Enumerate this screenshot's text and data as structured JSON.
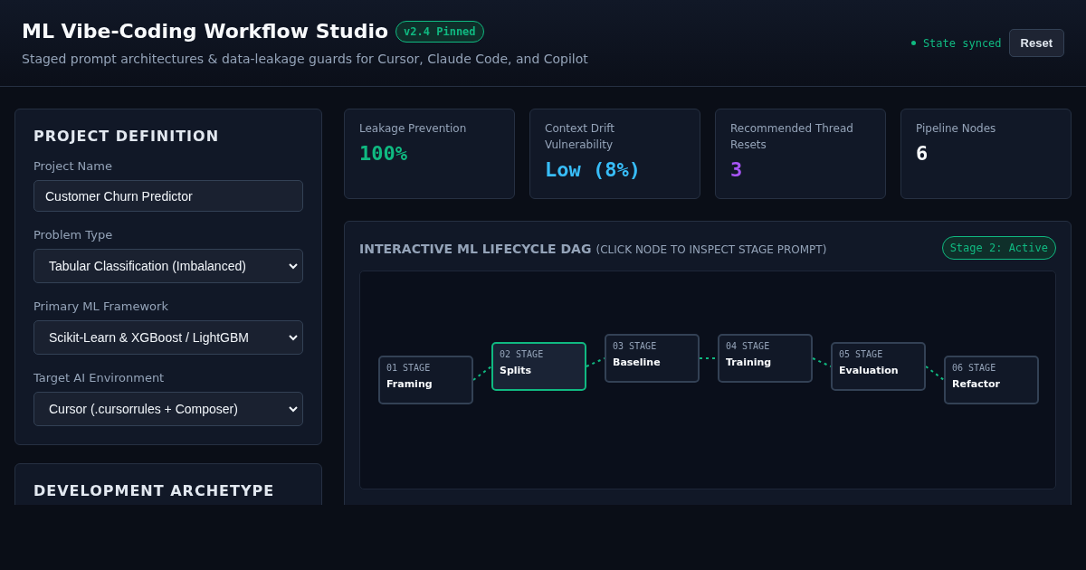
{
  "header": {
    "title": "ML Vibe-Coding Workflow Studio",
    "version_badge": "v2.4 Pinned",
    "subtitle": "Staged prompt architectures & data-leakage guards for Cursor, Claude Code, and Copilot",
    "sync_status": "State synced",
    "reset_button": "Reset"
  },
  "project_definition": {
    "title": "PROJECT DEFINITION",
    "fields": [
      {
        "kind": "text",
        "label": "Project Name",
        "value": "Customer Churn Predictor"
      },
      {
        "kind": "select",
        "label": "Problem Type",
        "value": "Tabular Classification (Imbalanced)"
      },
      {
        "kind": "select",
        "label": "Primary ML Framework",
        "value": "Scikit-Learn & XGBoost / LightGBM"
      },
      {
        "kind": "select",
        "label": "Target AI Environment",
        "value": "Cursor (.cursorrules + Composer)"
      }
    ]
  },
  "development_archetype": {
    "title": "DEVELOPMENT ARCHETYPE"
  },
  "metrics": [
    {
      "label": "Leakage Prevention",
      "value": "100%",
      "color": "#10b981"
    },
    {
      "label": "Context Drift Vulnerability",
      "value": "Low (8%)",
      "color": "#38bdf8"
    },
    {
      "label": "Recommended Thread Resets",
      "value": "3",
      "color": "#a855f7"
    },
    {
      "label": "Pipeline Nodes",
      "value": "6",
      "color": "#f8fafc"
    }
  ],
  "dag": {
    "title": "INTERACTIVE ML LIFECYCLE DAG",
    "hint": "(CLICK NODE TO INSPECT STAGE PROMPT)",
    "status_badge": "Stage 2: Active",
    "nodes": [
      {
        "stage": "01 STAGE",
        "name": "Framing",
        "selected": false
      },
      {
        "stage": "02 STAGE",
        "name": "Splits",
        "selected": true
      },
      {
        "stage": "03 STAGE",
        "name": "Baseline",
        "selected": false
      },
      {
        "stage": "04 STAGE",
        "name": "Training",
        "selected": false
      },
      {
        "stage": "05 STAGE",
        "name": "Evaluation",
        "selected": false
      },
      {
        "stage": "06 STAGE",
        "name": "Refactor",
        "selected": false
      }
    ]
  }
}
